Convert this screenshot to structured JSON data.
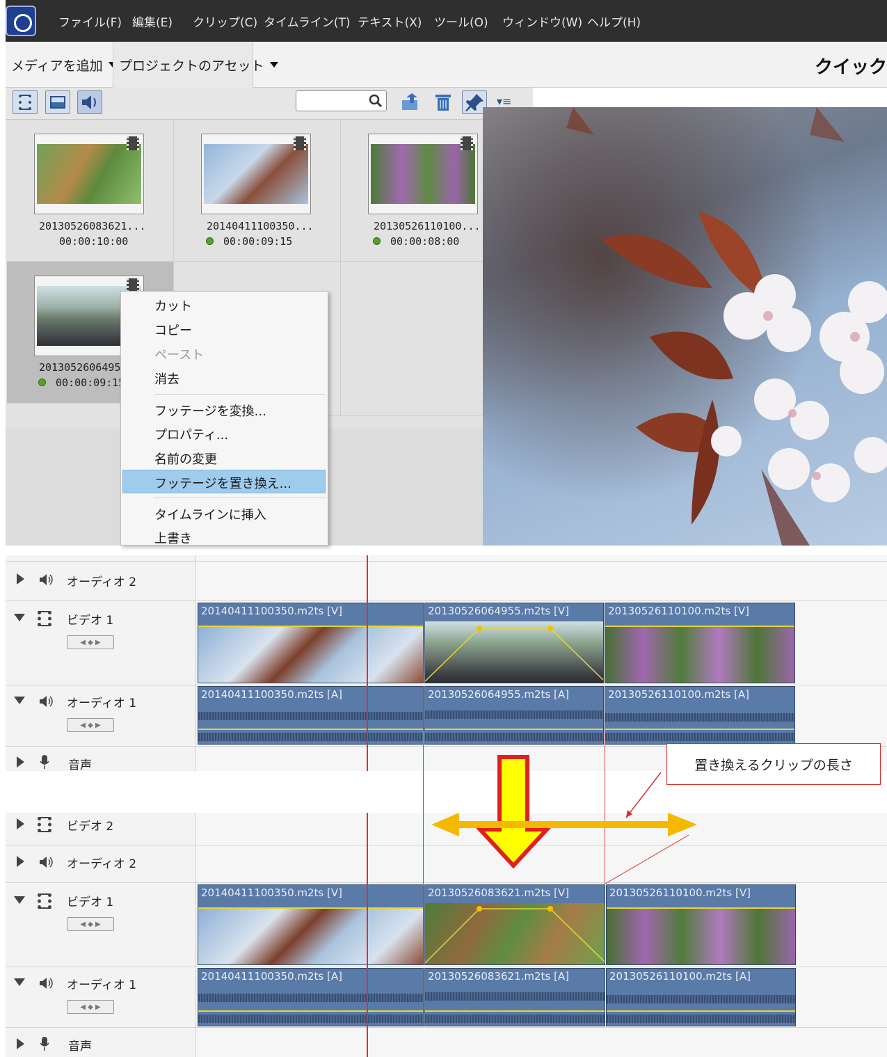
{
  "menu": [
    "ファイル(F)",
    "編集(E)",
    "クリップ(C)",
    "タイムライン(T)",
    "テキスト(X)",
    "ツール(O)",
    "ウィンドウ(W)",
    "ヘルプ(H)"
  ],
  "toolbar": {
    "add_media": "メディアを追加",
    "project_assets": "プロジェクトのアセット",
    "mode": "クイック"
  },
  "media": [
    {
      "name": "20130526083621...",
      "duration": "00:00:10:00"
    },
    {
      "name": "20140411100350...",
      "duration": "00:00:09:15"
    },
    {
      "name": "20130526110100...",
      "duration": "00:00:08:00"
    },
    {
      "name": "20130526064955",
      "duration": "00:00:09:15"
    }
  ],
  "context_menu": {
    "cut": "カット",
    "copy": "コピー",
    "paste": "ペースト",
    "clear": "消去",
    "convert": "フッテージを変換...",
    "properties": "プロパティ...",
    "rename": "名前の変更",
    "replace": "フッテージを置き換え...",
    "insert": "タイムラインに挿入",
    "overwrite": "上書き"
  },
  "tracks": {
    "video1": "ビデオ 1",
    "video2": "ビデオ 2",
    "audio1": "オーディオ 1",
    "audio2": "オーディオ 2",
    "narration": "音声"
  },
  "timeline_before": {
    "video": [
      "20140411100350.m2ts [V]",
      "20130526064955.m2ts [V]",
      "20130526110100.m2ts [V]"
    ],
    "audio": [
      "20140411100350.m2ts [A]",
      "20130526064955.m2ts [A]",
      "20130526110100.m2ts [A]"
    ]
  },
  "timeline_after": {
    "video": [
      "20140411100350.m2ts [V]",
      "20130526083621.m2ts [V]",
      "20130526110100.m2ts [V]"
    ],
    "audio": [
      "20140411100350.m2ts [A]",
      "20130526083621.m2ts [A]",
      "20130526110100.m2ts [A]"
    ]
  },
  "annotation": {
    "callout": "置き換えるクリップの長さ"
  },
  "colors": {
    "arrow_yellow": "#ffff00",
    "arrow_red": "#e02020",
    "span_orange": "#f5b800"
  }
}
